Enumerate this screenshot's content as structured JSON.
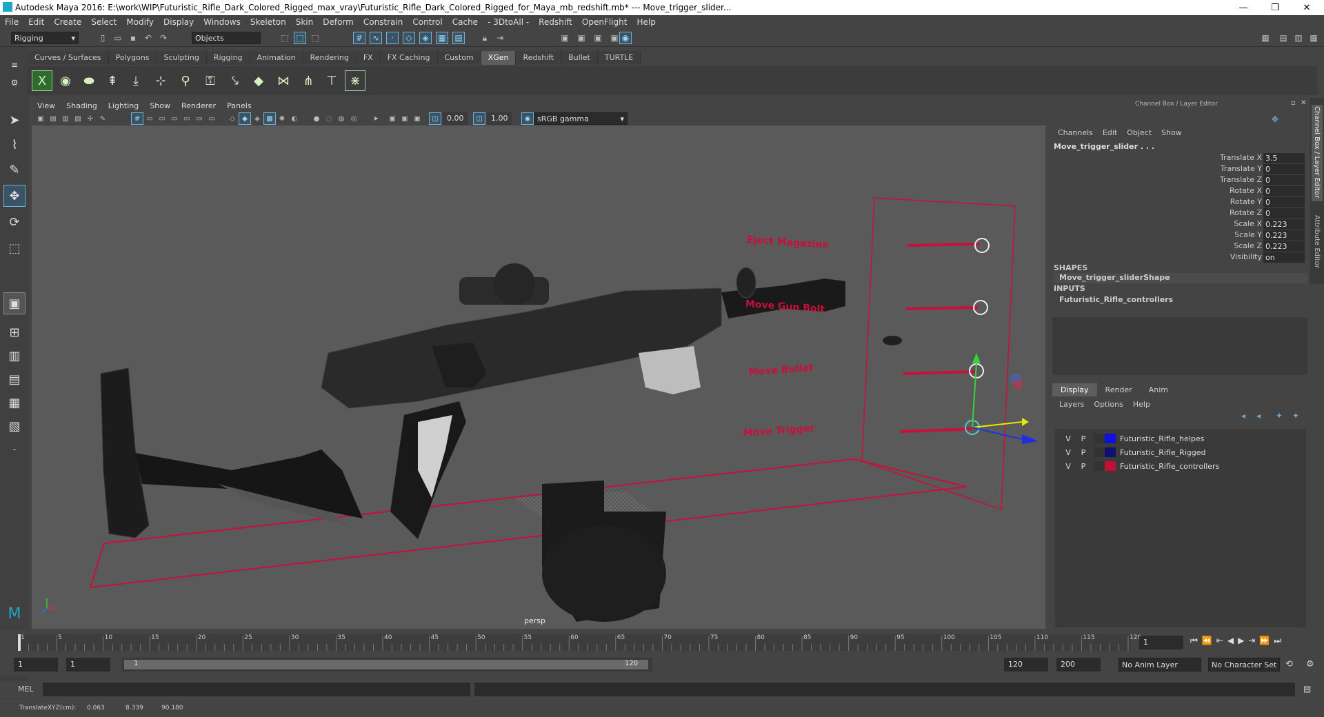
{
  "window": {
    "title": "Autodesk Maya 2016: E:\\work\\WIP\\Futuristic_Rifle_Dark_Colored_Rigged_max_vray\\Futuristic_Rifle_Dark_Colored_Rigged_for_Maya_mb_redshift.mb*   ---   Move_trigger_slider...",
    "min": "—",
    "max": "❐",
    "close": "✕"
  },
  "menu": [
    "File",
    "Edit",
    "Create",
    "Select",
    "Modify",
    "Display",
    "Windows",
    "Skeleton",
    "Skin",
    "Deform",
    "Constrain",
    "Control",
    "Cache",
    "- 3DtoAll -",
    "Redshift",
    "OpenFlight",
    "Help"
  ],
  "status": {
    "mode": "Rigging",
    "objects": "Objects"
  },
  "shelf_tabs": [
    "Curves / Surfaces",
    "Polygons",
    "Sculpting",
    "Rigging",
    "Animation",
    "Rendering",
    "FX",
    "FX Caching",
    "Custom",
    "XGen",
    "Redshift",
    "Bullet",
    "TURTLE"
  ],
  "shelf_active": "XGen",
  "viewport": {
    "menu": [
      "View",
      "Shading",
      "Lighting",
      "Show",
      "Renderer",
      "Panels"
    ],
    "near": "0.00",
    "far": "1.00",
    "colorspace": "sRGB gamma",
    "camera": "persp",
    "sliders": [
      "Eject Magazine",
      "Move Gun Bolt",
      "Move Bullet",
      "Move Trigger"
    ]
  },
  "channelbox": {
    "title": "Channel Box / Layer Editor",
    "menu": [
      "Channels",
      "Edit",
      "Object",
      "Show"
    ],
    "object": "Move_trigger_slider . . .",
    "attrs": [
      {
        "name": "Translate X",
        "value": "3.5"
      },
      {
        "name": "Translate Y",
        "value": "0"
      },
      {
        "name": "Translate Z",
        "value": "0"
      },
      {
        "name": "Rotate X",
        "value": "0"
      },
      {
        "name": "Rotate Y",
        "value": "0"
      },
      {
        "name": "Rotate Z",
        "value": "0"
      },
      {
        "name": "Scale X",
        "value": "0.223"
      },
      {
        "name": "Scale Y",
        "value": "0.223"
      },
      {
        "name": "Scale Z",
        "value": "0.223"
      },
      {
        "name": "Visibility",
        "value": "on"
      }
    ],
    "shapes_label": "SHAPES",
    "shape": "Move_trigger_sliderShape",
    "inputs_label": "INPUTS",
    "input": "Futuristic_Rifle_controllers"
  },
  "layer_editor": {
    "tabs": [
      "Display",
      "Render",
      "Anim"
    ],
    "menu": [
      "Layers",
      "Options",
      "Help"
    ],
    "layers": [
      {
        "v": "V",
        "p": "P",
        "name": "Futuristic_Rifle_helpes",
        "color": "#1010e0"
      },
      {
        "v": "V",
        "p": "P",
        "name": "Futuristic_Rifle_Rigged",
        "color": "#101070"
      },
      {
        "v": "V",
        "p": "P",
        "name": "Futuristic_Rifle_controllers",
        "color": "#c0103a"
      }
    ]
  },
  "side_tabs": [
    "Channel Box / Layer Editor",
    "Attribute Editor"
  ],
  "timeline": {
    "ticks": [
      "1",
      "5",
      "10",
      "15",
      "20",
      "25",
      "30",
      "35",
      "40",
      "45",
      "50",
      "55",
      "60",
      "65",
      "70",
      "75",
      "80",
      "85",
      "90",
      "95",
      "100",
      "105",
      "110",
      "115",
      "120"
    ],
    "current": "1"
  },
  "range": {
    "start": "1",
    "start2": "1",
    "slider_start": "1",
    "slider_end": "120",
    "end": "120",
    "end2": "200",
    "anim_layer": "No Anim Layer",
    "char_set": "No Character Set"
  },
  "cmd": {
    "label": "MEL"
  },
  "help": {
    "text": "TranslateXYZ(cm):",
    "x": "0.063",
    "y": "8.339",
    "z": "90.180"
  }
}
